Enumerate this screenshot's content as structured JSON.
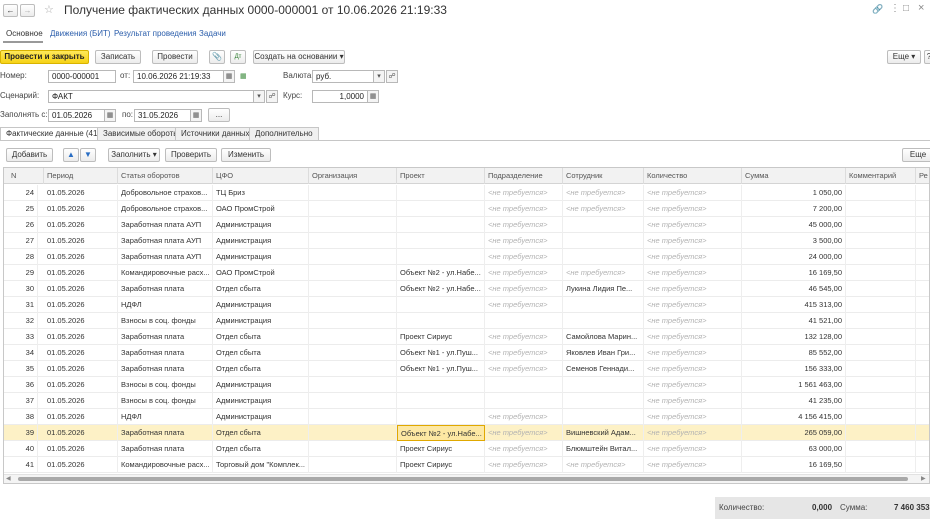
{
  "window": {
    "title": "Получение фактических данных 0000-000001 от 10.06.2026 21:19:33"
  },
  "nav_tabs": [
    "Основное",
    "Движения (БИТ)",
    "Результат проведения",
    "Задачи"
  ],
  "toolbar": {
    "post_close": "Провести и закрыть",
    "save": "Записать",
    "post": "Провести",
    "create_based": "Создать на основании",
    "more": "Еще"
  },
  "form": {
    "number_label": "Номер:",
    "number_value": "0000-000001",
    "from_label": "от:",
    "date_value": "10.06.2026 21:19:33",
    "currency_label": "Валюта:",
    "currency_value": "руб.",
    "scenario_label": "Сценарий:",
    "scenario_value": "ФАКТ",
    "rate_label": "Курс:",
    "rate_value": "1,0000",
    "fill_from_label": "Заполнять с:",
    "fill_from_value": "01.05.2026",
    "fill_to_label": "по:",
    "fill_to_value": "31.05.2026",
    "dots": "..."
  },
  "content_tabs": [
    "Фактические данные (41)",
    "Зависимые обороты",
    "Источники данных",
    "Дополнительно"
  ],
  "table_toolbar": {
    "add": "Добавить",
    "fill": "Заполнить",
    "check": "Проверить",
    "change": "Изменить",
    "more": "Еще"
  },
  "table": {
    "columns": [
      "N",
      "Период",
      "Статья оборотов",
      "ЦФО",
      "Организация",
      "Проект",
      "Подразделение",
      "Сотрудник",
      "Количество",
      "Сумма",
      "Комментарий",
      "Ре"
    ],
    "rows": [
      [
        "24",
        "01.05.2026",
        "Добровольное страхов...",
        "ТЦ Бриз",
        "",
        "",
        "<не требуется>",
        "<не требуется>",
        "<не требуется>",
        "1 050,00",
        ""
      ],
      [
        "25",
        "01.05.2026",
        "Добровольное страхов...",
        "ОАО ПромСтрой",
        "",
        "",
        "<не требуется>",
        "<не требуется>",
        "<не требуется>",
        "7 200,00",
        ""
      ],
      [
        "26",
        "01.05.2026",
        "Заработная плата АУП",
        "Администрация",
        "",
        "",
        "<не требуется>",
        "",
        "<не требуется>",
        "45 000,00",
        ""
      ],
      [
        "27",
        "01.05.2026",
        "Заработная плата АУП",
        "Администрация",
        "",
        "",
        "<не требуется>",
        "",
        "<не требуется>",
        "3 500,00",
        ""
      ],
      [
        "28",
        "01.05.2026",
        "Заработная плата АУП",
        "Администрация",
        "",
        "",
        "<не требуется>",
        "",
        "<не требуется>",
        "24 000,00",
        ""
      ],
      [
        "29",
        "01.05.2026",
        "Командировочные расх...",
        "ОАО ПромСтрой",
        "",
        "Объект №2 - ул.Набе...",
        "<не требуется>",
        "<не требуется>",
        "<не требуется>",
        "16 169,50",
        ""
      ],
      [
        "30",
        "01.05.2026",
        "Заработная плата",
        "Отдел сбыта",
        "",
        "Объект №2 - ул.Набе...",
        "<не требуется>",
        "Лукина Лидия Пе...",
        "<не требуется>",
        "46 545,00",
        ""
      ],
      [
        "31",
        "01.05.2026",
        "НДФЛ",
        "Администрация",
        "",
        "",
        "<не требуется>",
        "",
        "<не требуется>",
        "415 313,00",
        ""
      ],
      [
        "32",
        "01.05.2026",
        "Взносы в соц. фонды",
        "Администрация",
        "",
        "",
        "",
        "",
        "<не требуется>",
        "41 521,00",
        ""
      ],
      [
        "33",
        "01.05.2026",
        "Заработная плата",
        "Отдел сбыта",
        "",
        "Проект Сириус",
        "<не требуется>",
        "Самойлова Марин...",
        "<не требуется>",
        "132 128,00",
        ""
      ],
      [
        "34",
        "01.05.2026",
        "Заработная плата",
        "Отдел сбыта",
        "",
        "Объект №1 - ул.Пуш...",
        "<не требуется>",
        "Яковлев Иван Гри...",
        "<не требуется>",
        "85 552,00",
        ""
      ],
      [
        "35",
        "01.05.2026",
        "Заработная плата",
        "Отдел сбыта",
        "",
        "Объект №1 - ул.Пуш...",
        "<не требуется>",
        "Семенов Геннади...",
        "<не требуется>",
        "156 333,00",
        ""
      ],
      [
        "36",
        "01.05.2026",
        "Взносы в соц. фонды",
        "Администрация",
        "",
        "",
        "",
        "",
        "<не требуется>",
        "1 561 463,00",
        ""
      ],
      [
        "37",
        "01.05.2026",
        "Взносы в соц. фонды",
        "Администрация",
        "",
        "",
        "",
        "",
        "<не требуется>",
        "41 235,00",
        ""
      ],
      [
        "38",
        "01.05.2026",
        "НДФЛ",
        "Администрация",
        "",
        "",
        "<не требуется>",
        "",
        "<не требуется>",
        "4 156 415,00",
        ""
      ],
      [
        "39",
        "01.05.2026",
        "Заработная плата",
        "Отдел сбыта",
        "",
        "Объект №2 - ул.Набе...",
        "<не требуется>",
        "Вишневский Адам...",
        "<не требуется>",
        "265 059,00",
        ""
      ],
      [
        "40",
        "01.05.2026",
        "Заработная плата",
        "Отдел сбыта",
        "",
        "Проект Сириус",
        "<не требуется>",
        "Блюмштейн Витал...",
        "<не требуется>",
        "63 000,00",
        ""
      ],
      [
        "41",
        "01.05.2026",
        "Командировочные расх...",
        "Торговый дом \"Комплек...",
        "",
        "Проект Сириус",
        "<не требуется>",
        "<не требуется>",
        "<не требуется>",
        "16 169,50",
        ""
      ]
    ],
    "selected_row": 15
  },
  "footer": {
    "qty_label": "Количество:",
    "qty_value": "0,000",
    "sum_label": "Сумма:",
    "sum_value": "7 460 353,"
  },
  "colors": {
    "accent_yellow": "#f6d216",
    "link_blue": "#2a5dab",
    "selected_row": "#fdf1c6"
  }
}
